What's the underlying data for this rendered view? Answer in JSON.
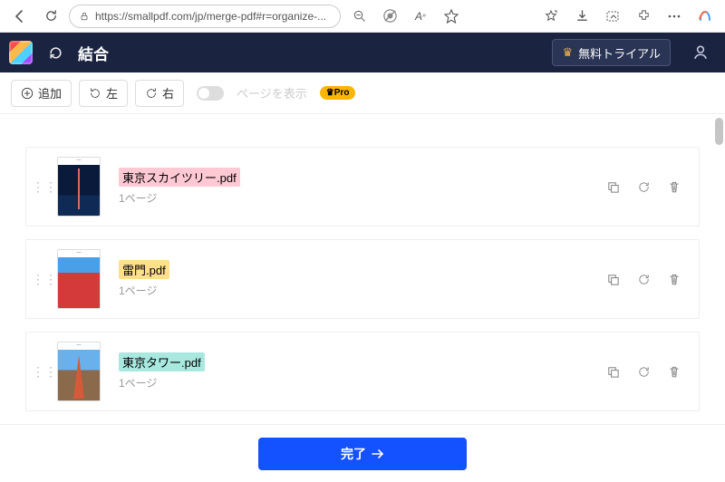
{
  "browser": {
    "url": "https://smallpdf.com/jp/merge-pdf#r=organize-..."
  },
  "header": {
    "title": "結合",
    "trial_label": "無料トライアル"
  },
  "toolbar": {
    "add": "追加",
    "rotate_left": "左",
    "rotate_right": "右",
    "toggle_label": "ページを表示",
    "pro_badge": "Pro"
  },
  "files": [
    {
      "name": "東京スカイツリー.pdf",
      "pages": "1ページ",
      "highlight": "hl-pink",
      "thumb": "t1"
    },
    {
      "name": "雷門.pdf",
      "pages": "1ページ",
      "highlight": "hl-yellow",
      "thumb": "t2"
    },
    {
      "name": "東京タワー.pdf",
      "pages": "1ページ",
      "highlight": "hl-teal",
      "thumb": "t3"
    }
  ],
  "footer": {
    "done": "完了"
  }
}
